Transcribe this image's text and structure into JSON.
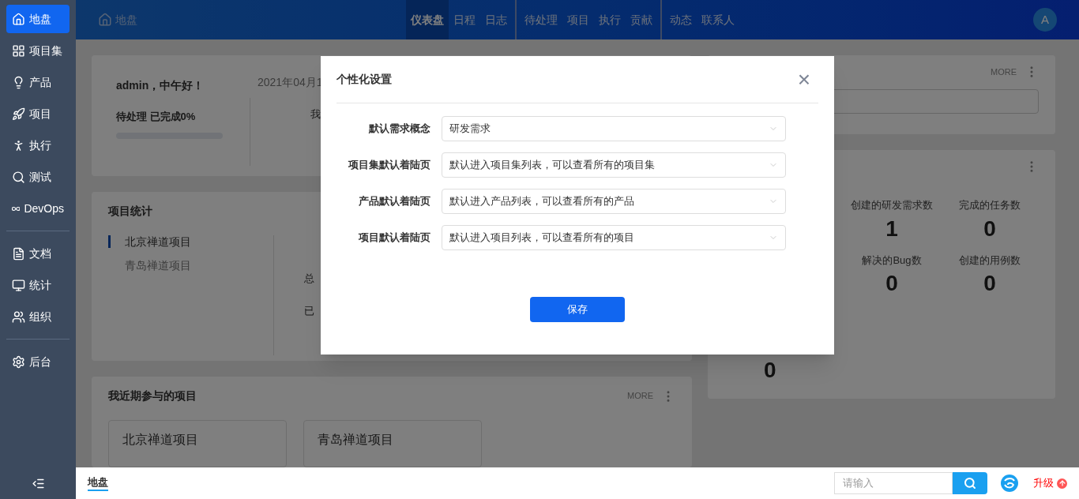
{
  "sidebar": {
    "groups": [
      [
        {
          "label": "地盘",
          "selected": true
        },
        {
          "label": "项目集",
          "selected": false
        },
        {
          "label": "产品",
          "selected": false
        },
        {
          "label": "项目",
          "selected": false
        },
        {
          "label": "执行",
          "selected": false
        },
        {
          "label": "测试",
          "selected": false
        },
        {
          "label": "DevOps",
          "selected": false
        }
      ],
      [
        {
          "label": "文档",
          "selected": false
        },
        {
          "label": "统计",
          "selected": false
        },
        {
          "label": "组织",
          "selected": false
        }
      ],
      [
        {
          "label": "后台",
          "selected": false
        }
      ]
    ]
  },
  "header": {
    "breadcrumb": "地盘",
    "nav_groups": [
      [
        {
          "label": "仪表盘",
          "selected": true
        },
        {
          "label": "日程",
          "selected": false
        },
        {
          "label": "日志",
          "selected": false
        }
      ],
      [
        {
          "label": "待处理",
          "selected": false
        },
        {
          "label": "项目",
          "selected": false
        },
        {
          "label": "执行",
          "selected": false
        },
        {
          "label": "贡献",
          "selected": false
        }
      ],
      [
        {
          "label": "动态",
          "selected": false
        },
        {
          "label": "联系人",
          "selected": false
        }
      ]
    ],
    "avatar": "A"
  },
  "welcome": {
    "greeting": "admin，中午好！",
    "date": "2021年04月1",
    "progress_label": "待处理 已完成0%",
    "level": 0,
    "partial": "我"
  },
  "project_stats": {
    "title": "项目统计",
    "projects": [
      {
        "label": "北京禅道项目",
        "selected": true
      },
      {
        "label": "青岛禅道项目",
        "selected": false
      }
    ],
    "partials": [
      "总",
      "已"
    ]
  },
  "recent_projects": {
    "title": "我近期参与的项目",
    "more": "MORE",
    "projects": [
      "北京禅道项目",
      "青岛禅道项目"
    ]
  },
  "right_top": {
    "more": "MORE"
  },
  "right_stats": {
    "stats": [
      {
        "label": "创建的研发需求数",
        "value": "1"
      },
      {
        "label": "完成的任务数",
        "value": "0"
      },
      {
        "label": "解决的Bug数",
        "value": "0"
      },
      {
        "label": "创建的用例数",
        "value": "0"
      }
    ],
    "partial_value": "0"
  },
  "dialog": {
    "title": "个性化设置",
    "close": "×",
    "rows": [
      {
        "label": "默认需求概念",
        "value": "研发需求"
      },
      {
        "label": "项目集默认着陆页",
        "value": "默认进入项目集列表，可以查看所有的项目集"
      },
      {
        "label": "产品默认着陆页",
        "value": "默认进入产品列表，可以查看所有的产品"
      },
      {
        "label": "项目默认着陆页",
        "value": "默认进入项目列表，可以查看所有的项目"
      }
    ],
    "save": "保存"
  },
  "footer": {
    "tab": "地盘",
    "search_placeholder": "请输入",
    "upgrade": "升级"
  }
}
